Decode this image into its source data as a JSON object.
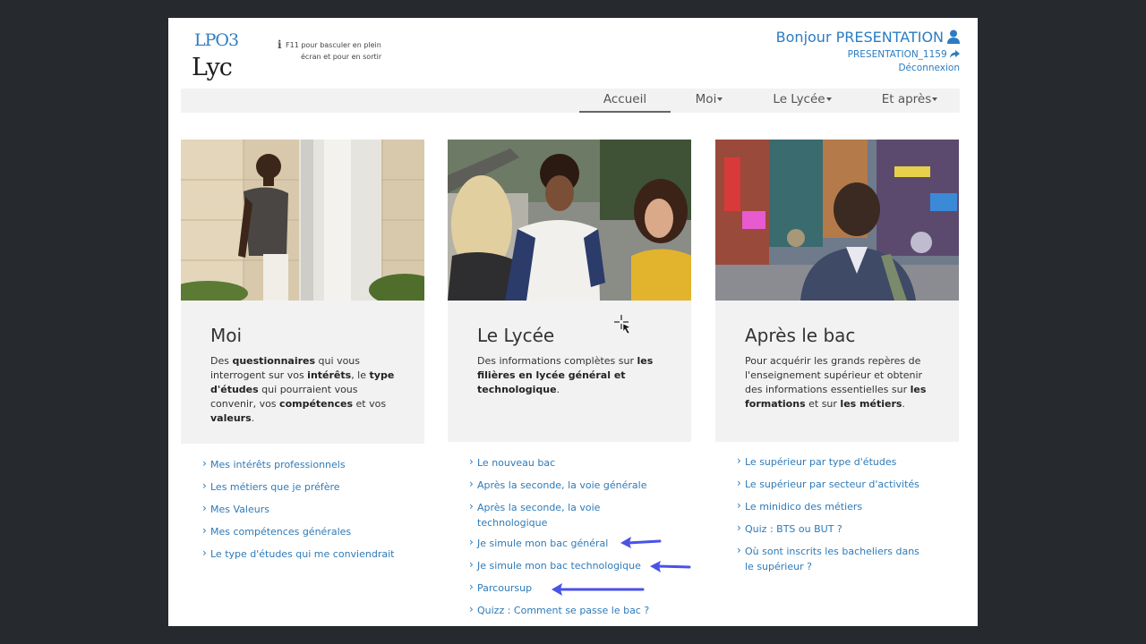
{
  "header": {
    "logo_top": "LPO3",
    "logo_bottom": "Lyc",
    "info_line1": "F11 pour basculer en plein",
    "info_line2": "écran et pour en sortir",
    "greeting": "Bonjour PRESENTATION",
    "username": "PRESENTATION_1159",
    "logout": "Déconnexion"
  },
  "nav": {
    "items": [
      {
        "label": "Accueil"
      },
      {
        "label": "Moi"
      },
      {
        "label": "Le Lycée"
      },
      {
        "label": "Et après"
      }
    ]
  },
  "cards": [
    {
      "title": "Moi",
      "desc": [
        {
          "t": "Des ",
          "b": false
        },
        {
          "t": "questionnaires",
          "b": true
        },
        {
          "t": " qui vous interrogent sur vos ",
          "b": false
        },
        {
          "t": "intérêts",
          "b": true
        },
        {
          "t": ", le ",
          "b": false
        },
        {
          "t": "type d'études",
          "b": true
        },
        {
          "t": " qui pourraient vous convenir, vos ",
          "b": false
        },
        {
          "t": "compétences",
          "b": true
        },
        {
          "t": " et vos ",
          "b": false
        },
        {
          "t": "valeurs",
          "b": true
        },
        {
          "t": ".",
          "b": false
        }
      ],
      "links": [
        "Mes intérêts professionnels",
        "Les métiers que je préfère",
        "Mes Valeurs",
        "Mes compétences générales",
        "Le type d'études qui me conviendrait"
      ]
    },
    {
      "title": "Le Lycée",
      "desc": [
        {
          "t": "Des informations complètes sur ",
          "b": false
        },
        {
          "t": "les filières en lycée général et technologique",
          "b": true
        },
        {
          "t": ".",
          "b": false
        }
      ],
      "links": [
        "Le nouveau bac",
        "Après la seconde, la voie générale",
        "Après la seconde, la voie technologique",
        "Je simule mon bac général",
        "Je simule mon bac technologique",
        "Parcoursup",
        "Quizz : Comment se passe le bac ?"
      ]
    },
    {
      "title": "Après le bac",
      "desc": [
        {
          "t": "Pour acquérir les grands repères de l'enseignement supérieur et obtenir des informations essentielles sur ",
          "b": false
        },
        {
          "t": "les formations",
          "b": true
        },
        {
          "t": " et sur ",
          "b": false
        },
        {
          "t": "les métiers",
          "b": true
        },
        {
          "t": ".",
          "b": false
        }
      ],
      "links": [
        "Le supérieur par type d'études",
        "Le supérieur par secteur d'activités",
        "Le minidico des métiers",
        "Quiz : BTS ou BUT ?",
        "Où sont inscrits les bacheliers dans le supérieur ?"
      ]
    }
  ],
  "colors": {
    "accent": "#2b7cc2",
    "annotation_arrow": "#4a52e8",
    "panel": "#f2f2f2"
  }
}
